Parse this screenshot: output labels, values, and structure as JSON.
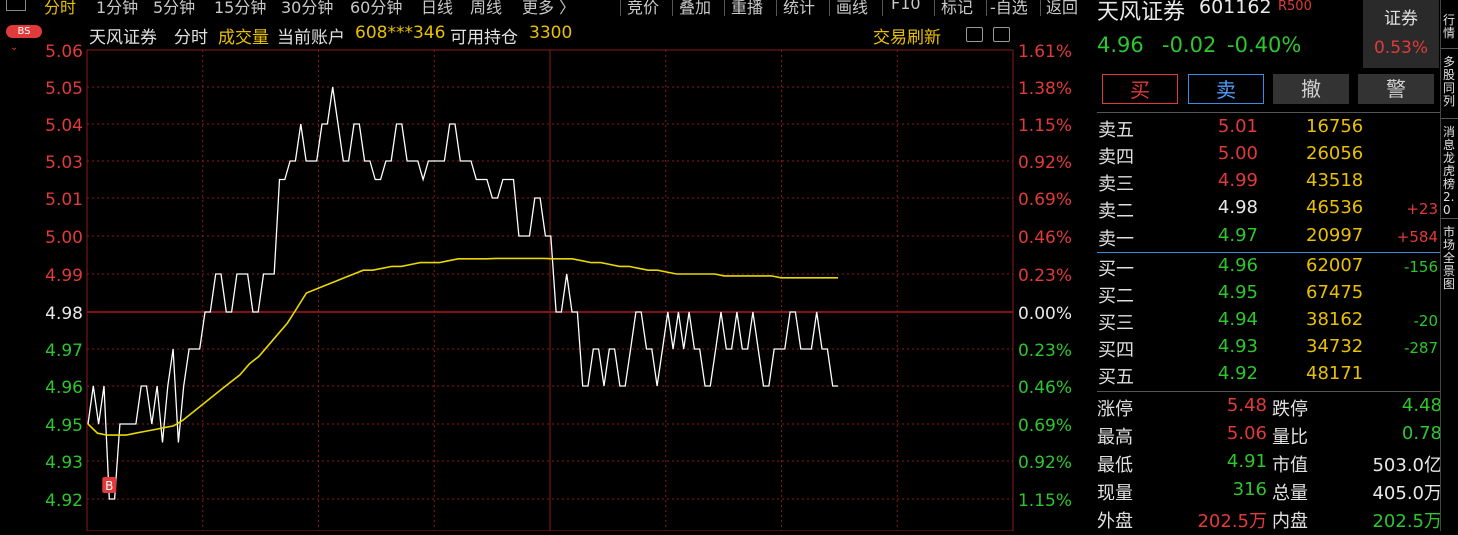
{
  "period_tabs": [
    {
      "label": "分时",
      "active": true
    },
    {
      "label": "1分钟",
      "active": false
    },
    {
      "label": "5分钟",
      "active": false
    },
    {
      "label": "15分钟",
      "active": false
    },
    {
      "label": "30分钟",
      "active": false
    },
    {
      "label": "60分钟",
      "active": false
    },
    {
      "label": "日线",
      "active": false
    },
    {
      "label": "周线",
      "active": false
    },
    {
      "label": "更多 〉",
      "active": false
    }
  ],
  "tool_tabs": [
    "竞价",
    "叠加",
    "重播",
    "统计",
    "画线",
    "F10",
    "标记",
    "-自选",
    "返回"
  ],
  "chart_header": {
    "badge": "BS",
    "name": "天风证券",
    "mode": "分时",
    "volume_label": "成交量",
    "account_label": "当前账户",
    "account_value": "608***346",
    "position_label": "可用持仓",
    "position_value": "3300",
    "refresh_label": "交易刷新"
  },
  "chart_data": {
    "type": "line",
    "xlabel": "",
    "ylabel": "",
    "prev_close": 4.98,
    "ylim": [
      4.91,
      5.06
    ],
    "price_ticks": [
      "5.06",
      "5.05",
      "5.04",
      "5.03",
      "5.01",
      "5.00",
      "4.99",
      "4.98",
      "4.97",
      "4.96",
      "4.95",
      "4.93",
      "4.92"
    ],
    "pct_ticks": [
      "1.61%",
      "1.38%",
      "1.15%",
      "0.92%",
      "0.69%",
      "0.46%",
      "0.23%",
      "0.00%",
      "0.23%",
      "0.46%",
      "0.69%",
      "0.92%",
      "1.15%"
    ],
    "trade_marker": {
      "label": "B",
      "index": 4,
      "price": 4.92
    },
    "series": [
      {
        "values": [
          4.95,
          4.96,
          4.95,
          4.96,
          4.92,
          4.92,
          4.95,
          4.95,
          4.95,
          4.95,
          4.96,
          4.96,
          4.95,
          4.96,
          4.94,
          4.96,
          4.97,
          4.94,
          4.96,
          4.97,
          4.97,
          4.97,
          4.98,
          4.98,
          4.99,
          4.99,
          4.98,
          4.98,
          4.99,
          4.99,
          4.99,
          4.98,
          4.98,
          4.99,
          4.99,
          4.99,
          5.02,
          5.02,
          5.03,
          5.03,
          5.04,
          5.03,
          5.03,
          5.03,
          5.04,
          5.04,
          5.05,
          5.04,
          5.03,
          5.03,
          5.04,
          5.04,
          5.03,
          5.03,
          5.02,
          5.02,
          5.03,
          5.03,
          5.04,
          5.04,
          5.03,
          5.03,
          5.03,
          5.02,
          5.03,
          5.03,
          5.03,
          5.03,
          5.04,
          5.04,
          5.03,
          5.03,
          5.03,
          5.02,
          5.02,
          5.02,
          5.01,
          5.01,
          5.02,
          5.02,
          5.02,
          5.0,
          5.0,
          5.0,
          5.01,
          5.01,
          5.0,
          5.0,
          4.98,
          4.98,
          4.99,
          4.98,
          4.98,
          4.96,
          4.96,
          4.97,
          4.97,
          4.96,
          4.97,
          4.97,
          4.96,
          4.96,
          4.97,
          4.98,
          4.98,
          4.97,
          4.97,
          4.96,
          4.97,
          4.98,
          4.97,
          4.98,
          4.97,
          4.98,
          4.97,
          4.97,
          4.96,
          4.96,
          4.97,
          4.98,
          4.97,
          4.97,
          4.98,
          4.97,
          4.97,
          4.98,
          4.97,
          4.96,
          4.96,
          4.97,
          4.97,
          4.97,
          4.98,
          4.98,
          4.97,
          4.97,
          4.97,
          4.98,
          4.97,
          4.97,
          4.96,
          4.96
        ]
      },
      {
        "values": [
          4.95,
          4.945,
          4.944,
          4.944,
          4.944,
          4.945,
          4.946,
          4.947,
          4.948,
          4.949,
          4.951,
          4.953,
          4.955,
          4.957,
          4.959,
          4.961,
          4.963,
          4.966,
          4.968,
          4.971,
          4.974,
          4.977,
          4.981,
          4.985,
          4.986,
          4.987,
          4.988,
          4.989,
          4.99,
          4.991,
          4.991,
          4.9915,
          4.992,
          4.992,
          4.9925,
          4.993,
          4.993,
          4.993,
          4.9935,
          4.994,
          4.994,
          4.994,
          4.994,
          4.9941,
          4.9941,
          4.9941,
          4.9941,
          4.9941,
          4.9941,
          4.994,
          4.994,
          4.994,
          4.9935,
          4.993,
          4.993,
          4.9925,
          4.992,
          4.992,
          4.9915,
          4.991,
          4.991,
          4.9905,
          4.99,
          4.99,
          4.99,
          4.99,
          4.99,
          4.9895,
          4.9895,
          4.9895,
          4.9895,
          4.9895,
          4.9895,
          4.989,
          4.989,
          4.989,
          4.989,
          4.989,
          4.989,
          4.989
        ]
      }
    ]
  },
  "quote": {
    "name": "天风证券",
    "code": "601162",
    "tag": "R500",
    "price": "4.96",
    "change": "-0.02",
    "change_pct": "-0.40%",
    "sector_label": "证券",
    "sector_pct": "0.53%"
  },
  "actions": {
    "buy": "买",
    "sell": "卖",
    "cancel": "撤",
    "alarm": "警"
  },
  "sell_book": [
    {
      "label": "卖五",
      "price": "5.01",
      "vol": "16756",
      "chg": ""
    },
    {
      "label": "卖四",
      "price": "5.00",
      "vol": "26056",
      "chg": ""
    },
    {
      "label": "卖三",
      "price": "4.99",
      "vol": "43518",
      "chg": ""
    },
    {
      "label": "卖二",
      "price": "4.98",
      "vol": "46536",
      "chg": "+23"
    },
    {
      "label": "卖一",
      "price": "4.97",
      "vol": "20997",
      "chg": "+584"
    }
  ],
  "buy_book": [
    {
      "label": "买一",
      "price": "4.96",
      "vol": "62007",
      "chg": "-156"
    },
    {
      "label": "买二",
      "price": "4.95",
      "vol": "67475",
      "chg": ""
    },
    {
      "label": "买三",
      "price": "4.94",
      "vol": "38162",
      "chg": "-20"
    },
    {
      "label": "买四",
      "price": "4.93",
      "vol": "34732",
      "chg": "-287"
    },
    {
      "label": "买五",
      "price": "4.92",
      "vol": "48171",
      "chg": ""
    }
  ],
  "stats_left": [
    {
      "label": "涨停",
      "value": "5.48"
    },
    {
      "label": "最高",
      "value": "5.06"
    },
    {
      "label": "最低",
      "value": "4.91"
    },
    {
      "label": "现量",
      "value": "316"
    },
    {
      "label": "外盘",
      "value": "202.5万"
    }
  ],
  "stats_right": [
    {
      "label": "跌停",
      "value": "4.48"
    },
    {
      "label": "量比",
      "value": "0.78"
    },
    {
      "label": "市值",
      "value": "503.0亿"
    },
    {
      "label": "总量",
      "value": "405.0万"
    },
    {
      "label": "内盘",
      "value": "202.5万"
    }
  ],
  "sidebar": [
    "行情",
    "多股同列",
    "消息龙虎榜2.0",
    "市场全景图"
  ],
  "colors": {
    "up": "#e03a3a",
    "down": "#2ec62e",
    "flat": "#e8e8e8",
    "volume": "#e8c000",
    "avg_line": "#e8d800",
    "price_line": "#ffffff",
    "grid": "#8a1a1a"
  }
}
